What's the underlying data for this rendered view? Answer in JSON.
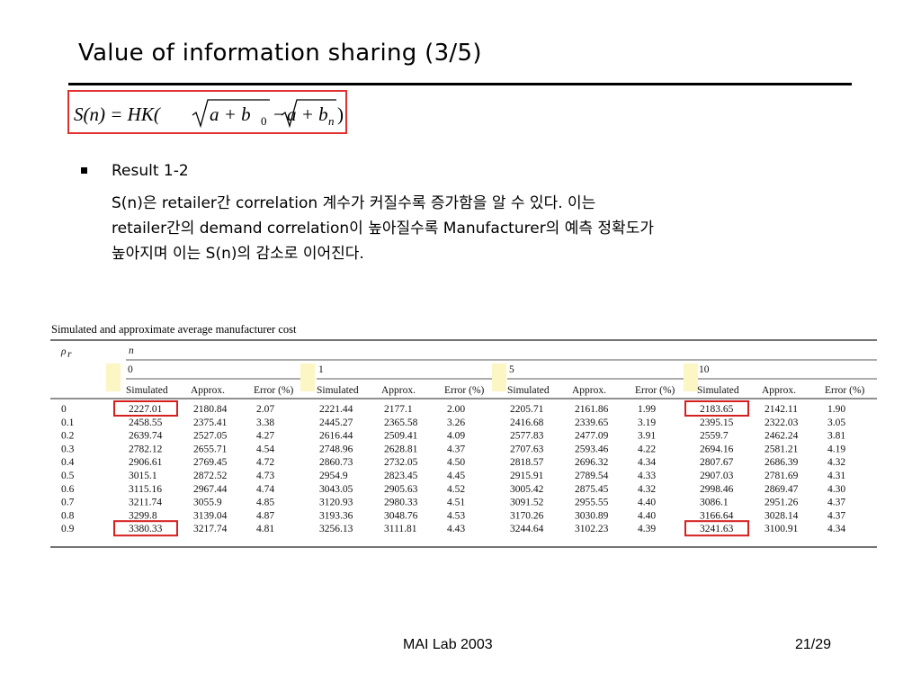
{
  "slide": {
    "title": "Value of information sharing (3/5)",
    "formula": {
      "lhs": "S(n) = HK(",
      "term1": "a + b",
      "sub1": "0",
      "minus": "−",
      "term2": "a + b",
      "sub2": "n",
      "close": ")"
    },
    "bullet_heading": "Result 1-2",
    "bullet_lines": [
      "S(n)은 retailer간 correlation 계수가 커질수록 증가함을 알 수 있다. 이는",
      "retailer간의 demand correlation이 높아질수록 Manufacturer의 예측 정확도가",
      "높아지며 이는 S(n)의 감소로 이어진다."
    ]
  },
  "table": {
    "caption": "Simulated and approximate average manufacturer cost",
    "row_header_symbol": "ρ",
    "row_header_sub": "r",
    "n_header": "n",
    "groups": [
      "0",
      "1",
      "5",
      "10"
    ],
    "sub_headers": [
      "Simulated",
      "Approx.",
      "Error (%)"
    ],
    "rows": [
      {
        "rho": "0",
        "cells": [
          "2227.01",
          "2180.84",
          "2.07",
          "2221.44",
          "2177.1",
          "2.00",
          "2205.71",
          "2161.86",
          "1.99",
          "2183.65",
          "2142.11",
          "1.90"
        ]
      },
      {
        "rho": "0.1",
        "cells": [
          "2458.55",
          "2375.41",
          "3.38",
          "2445.27",
          "2365.58",
          "3.26",
          "2416.68",
          "2339.65",
          "3.19",
          "2395.15",
          "2322.03",
          "3.05"
        ]
      },
      {
        "rho": "0.2",
        "cells": [
          "2639.74",
          "2527.05",
          "4.27",
          "2616.44",
          "2509.41",
          "4.09",
          "2577.83",
          "2477.09",
          "3.91",
          "2559.7",
          "2462.24",
          "3.81"
        ]
      },
      {
        "rho": "0.3",
        "cells": [
          "2782.12",
          "2655.71",
          "4.54",
          "2748.96",
          "2628.81",
          "4.37",
          "2707.63",
          "2593.46",
          "4.22",
          "2694.16",
          "2581.21",
          "4.19"
        ]
      },
      {
        "rho": "0.4",
        "cells": [
          "2906.61",
          "2769.45",
          "4.72",
          "2860.73",
          "2732.05",
          "4.50",
          "2818.57",
          "2696.32",
          "4.34",
          "2807.67",
          "2686.39",
          "4.32"
        ]
      },
      {
        "rho": "0.5",
        "cells": [
          "3015.1",
          "2872.52",
          "4.73",
          "2954.9",
          "2823.45",
          "4.45",
          "2915.91",
          "2789.54",
          "4.33",
          "2907.03",
          "2781.69",
          "4.31"
        ]
      },
      {
        "rho": "0.6",
        "cells": [
          "3115.16",
          "2967.44",
          "4.74",
          "3043.05",
          "2905.63",
          "4.52",
          "3005.42",
          "2875.45",
          "4.32",
          "2998.46",
          "2869.47",
          "4.30"
        ]
      },
      {
        "rho": "0.7",
        "cells": [
          "3211.74",
          "3055.9",
          "4.85",
          "3120.93",
          "2980.33",
          "4.51",
          "3091.52",
          "2955.55",
          "4.40",
          "3086.1",
          "2951.26",
          "4.37"
        ]
      },
      {
        "rho": "0.8",
        "cells": [
          "3299.8",
          "3139.04",
          "4.87",
          "3193.36",
          "3048.76",
          "4.53",
          "3170.26",
          "3030.89",
          "4.40",
          "3166.64",
          "3028.14",
          "4.37"
        ]
      },
      {
        "rho": "0.9",
        "cells": [
          "3380.33",
          "3217.74",
          "4.81",
          "3256.13",
          "3111.81",
          "4.43",
          "3244.64",
          "3102.23",
          "4.39",
          "3241.63",
          "3100.91",
          "4.34"
        ]
      }
    ],
    "highlighted": [
      {
        "row": 0,
        "col": 0
      },
      {
        "row": 9,
        "col": 0
      },
      {
        "row": 0,
        "col": 9
      },
      {
        "row": 9,
        "col": 9
      }
    ],
    "highlight_color": "#d42020",
    "marker_color": "#fbf6c4"
  },
  "footer": {
    "center": "MAI Lab 2003",
    "page": "21/29"
  }
}
